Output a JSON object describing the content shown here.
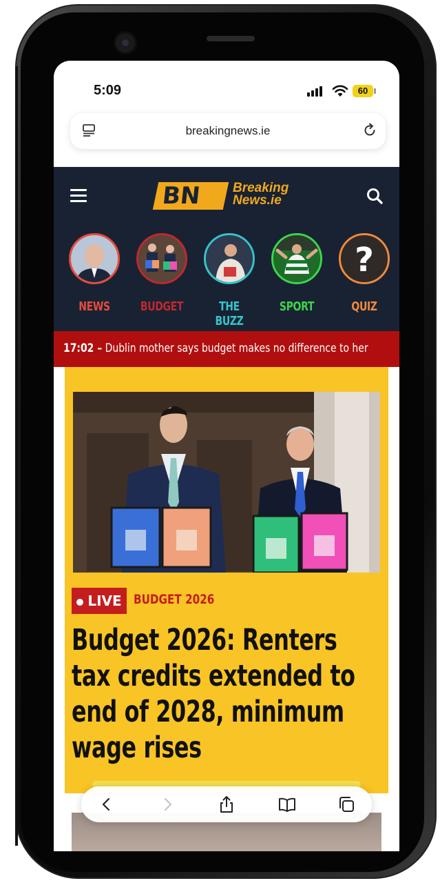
{
  "status_bar": {
    "time": "5:09",
    "battery": "60"
  },
  "browser": {
    "url": "breakingnews.ie"
  },
  "site": {
    "logo_mark": "BN",
    "logo_line1": "Breaking",
    "logo_line2": "News.ie"
  },
  "stories": [
    {
      "label": "NEWS",
      "color": "#e84a3c"
    },
    {
      "label": "BUDGET",
      "color": "#c0282e"
    },
    {
      "label": "THE BUZZ",
      "color": "#35c4c9"
    },
    {
      "label": "SPORT",
      "color": "#3bd64a"
    },
    {
      "label": "QUIZ",
      "color": "#f08a3c"
    }
  ],
  "ticker": {
    "time": "17:02 –",
    "text": "Dublin mother says budget makes no difference to her"
  },
  "article": {
    "badge": "LIVE",
    "category": "BUDGET 2026",
    "headline_lines": [
      "Budget 2026: Renters",
      "tax credits extended to",
      "end of 2028, minimum",
      "wage rises"
    ]
  },
  "icons": [
    "reader-icon",
    "reload-icon",
    "menu-icon",
    "search-icon",
    "back-icon",
    "forward-icon",
    "share-icon",
    "bookmarks-icon",
    "tabs-icon"
  ]
}
